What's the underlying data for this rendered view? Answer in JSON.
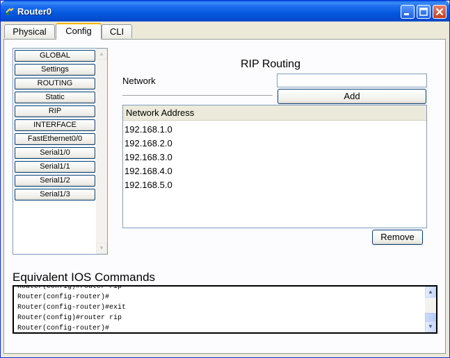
{
  "window": {
    "title": "Router0"
  },
  "tabs": [
    {
      "label": "Physical",
      "active": false
    },
    {
      "label": "Config",
      "active": true
    },
    {
      "label": "CLI",
      "active": false
    }
  ],
  "sidebar": {
    "items": [
      {
        "label": "GLOBAL"
      },
      {
        "label": "Settings"
      },
      {
        "label": "ROUTING"
      },
      {
        "label": "Static"
      },
      {
        "label": "RIP"
      },
      {
        "label": "INTERFACE"
      },
      {
        "label": "FastEthernet0/0"
      },
      {
        "label": "Serial1/0"
      },
      {
        "label": "Serial1/1"
      },
      {
        "label": "Serial1/2"
      },
      {
        "label": "Serial1/3"
      }
    ]
  },
  "rip": {
    "title": "RIP Routing",
    "network_label": "Network",
    "network_value": "",
    "add_label": "Add",
    "remove_label": "Remove",
    "list_header": "Network Address",
    "networks": [
      "192.168.1.0",
      "192.168.2.0",
      "192.168.3.0",
      "192.168.4.0",
      "192.168.5.0"
    ]
  },
  "ios": {
    "label": "Equivalent IOS Commands",
    "lines": [
      "Router(config)#router rip",
      "Router(config-router)#",
      "Router(config-router)#exit",
      "Router(config)#router rip",
      "Router(config-router)#"
    ]
  },
  "icons": {
    "app": "router-icon",
    "minimize": "minimize-icon",
    "maximize": "maximize-icon",
    "close": "close-icon",
    "scroll_up": "scroll-up-arrow-icon",
    "scroll_down": "scroll-down-arrow-icon"
  },
  "colors": {
    "titlebar": "#0458DE",
    "active_tab_accent": "#F4B400",
    "panel_bg": "#FCFCFE",
    "window_bg": "#ECE9D8"
  }
}
